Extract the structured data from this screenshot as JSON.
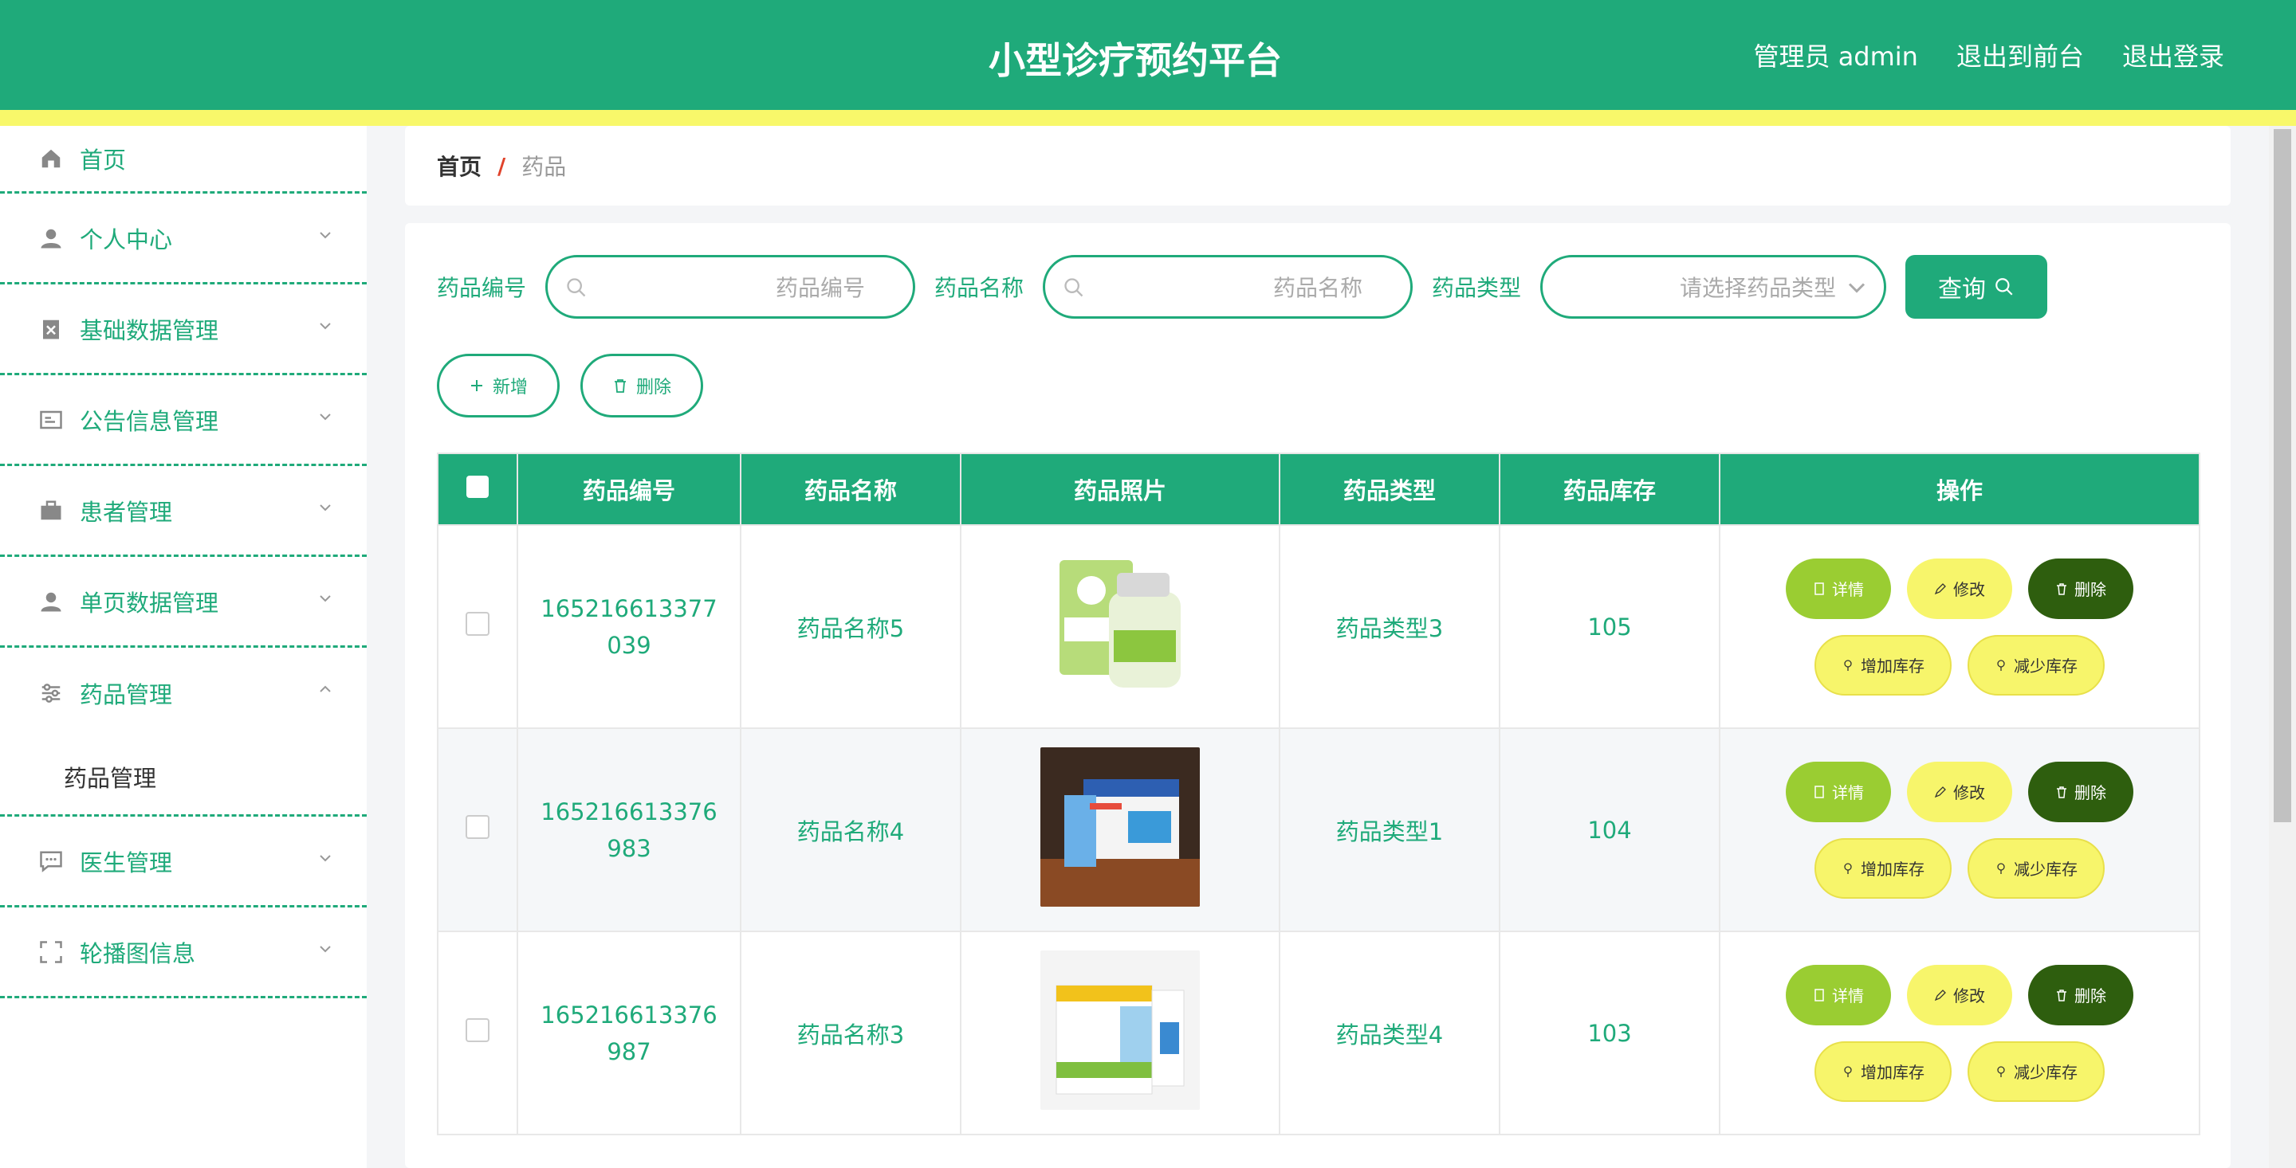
{
  "header": {
    "title": "小型诊疗预约平台",
    "links": [
      "管理员 admin",
      "退出到前台",
      "退出登录"
    ]
  },
  "sidebar": {
    "items": [
      {
        "label": "首页",
        "icon": "home-icon"
      },
      {
        "label": "个人中心",
        "icon": "user-icon"
      },
      {
        "label": "基础数据管理",
        "icon": "clipboard-icon"
      },
      {
        "label": "公告信息管理",
        "icon": "notice-icon"
      },
      {
        "label": "患者管理",
        "icon": "briefcase-icon"
      },
      {
        "label": "单页数据管理",
        "icon": "user-icon"
      },
      {
        "label": "药品管理",
        "icon": "sliders-icon"
      },
      {
        "label": "医生管理",
        "icon": "chat-icon"
      },
      {
        "label": "轮播图信息",
        "icon": "frame-icon"
      }
    ],
    "sub_item": "药品管理"
  },
  "breadcrumb": {
    "home": "首页",
    "separator": "/",
    "current": "药品"
  },
  "search": {
    "label_code": "药品编号",
    "placeholder_code": "药品编号",
    "label_name": "药品名称",
    "placeholder_name": "药品名称",
    "label_type": "药品类型",
    "placeholder_type": "请选择药品类型",
    "query_label": "查询"
  },
  "actions": {
    "add_label": "新增",
    "delete_label": "删除"
  },
  "table": {
    "headers": [
      "药品编号",
      "药品名称",
      "药品照片",
      "药品类型",
      "药品库存",
      "操作"
    ],
    "rows": [
      {
        "code": "165216613377039",
        "name": "药品名称5",
        "type": "药品类型3",
        "stock": "105"
      },
      {
        "code": "165216613376983",
        "name": "药品名称4",
        "type": "药品类型1",
        "stock": "104"
      },
      {
        "code": "165216613376987",
        "name": "药品名称3",
        "type": "药品类型4",
        "stock": "103"
      }
    ],
    "ops": {
      "detail": "详情",
      "edit": "修改",
      "delete": "删除",
      "increase": "增加库存",
      "decrease": "减少库存"
    }
  },
  "colors": {
    "primary": "#1faa7a",
    "stripe": "#f8f86a",
    "delete_dark": "#2e5e0e",
    "yellow": "#f7f56b",
    "green_light": "#9acd32"
  }
}
